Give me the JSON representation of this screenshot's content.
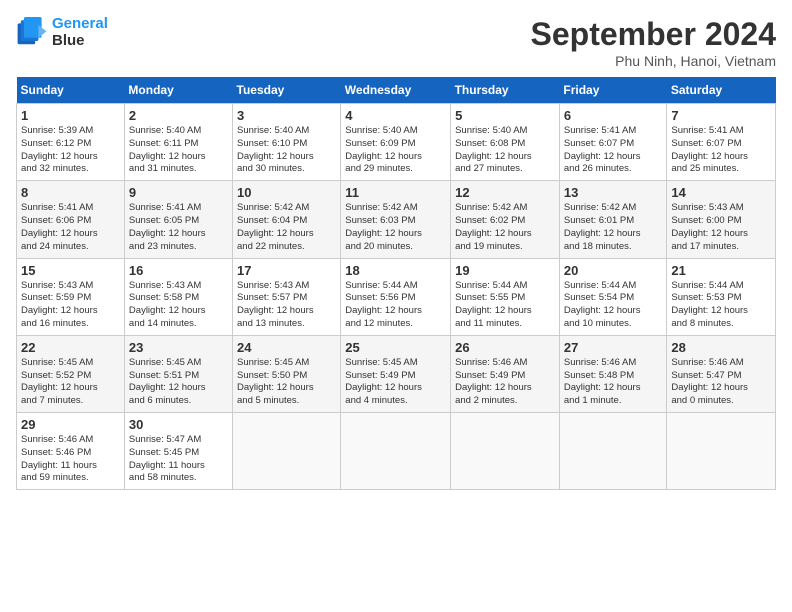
{
  "header": {
    "logo_line1": "General",
    "logo_line2": "Blue",
    "month_title": "September 2024",
    "subtitle": "Phu Ninh, Hanoi, Vietnam"
  },
  "days_of_week": [
    "Sunday",
    "Monday",
    "Tuesday",
    "Wednesday",
    "Thursday",
    "Friday",
    "Saturday"
  ],
  "weeks": [
    [
      {
        "day": "1",
        "info": "Sunrise: 5:39 AM\nSunset: 6:12 PM\nDaylight: 12 hours\nand 32 minutes."
      },
      {
        "day": "2",
        "info": "Sunrise: 5:40 AM\nSunset: 6:11 PM\nDaylight: 12 hours\nand 31 minutes."
      },
      {
        "day": "3",
        "info": "Sunrise: 5:40 AM\nSunset: 6:10 PM\nDaylight: 12 hours\nand 30 minutes."
      },
      {
        "day": "4",
        "info": "Sunrise: 5:40 AM\nSunset: 6:09 PM\nDaylight: 12 hours\nand 29 minutes."
      },
      {
        "day": "5",
        "info": "Sunrise: 5:40 AM\nSunset: 6:08 PM\nDaylight: 12 hours\nand 27 minutes."
      },
      {
        "day": "6",
        "info": "Sunrise: 5:41 AM\nSunset: 6:07 PM\nDaylight: 12 hours\nand 26 minutes."
      },
      {
        "day": "7",
        "info": "Sunrise: 5:41 AM\nSunset: 6:07 PM\nDaylight: 12 hours\nand 25 minutes."
      }
    ],
    [
      {
        "day": "8",
        "info": "Sunrise: 5:41 AM\nSunset: 6:06 PM\nDaylight: 12 hours\nand 24 minutes."
      },
      {
        "day": "9",
        "info": "Sunrise: 5:41 AM\nSunset: 6:05 PM\nDaylight: 12 hours\nand 23 minutes."
      },
      {
        "day": "10",
        "info": "Sunrise: 5:42 AM\nSunset: 6:04 PM\nDaylight: 12 hours\nand 22 minutes."
      },
      {
        "day": "11",
        "info": "Sunrise: 5:42 AM\nSunset: 6:03 PM\nDaylight: 12 hours\nand 20 minutes."
      },
      {
        "day": "12",
        "info": "Sunrise: 5:42 AM\nSunset: 6:02 PM\nDaylight: 12 hours\nand 19 minutes."
      },
      {
        "day": "13",
        "info": "Sunrise: 5:42 AM\nSunset: 6:01 PM\nDaylight: 12 hours\nand 18 minutes."
      },
      {
        "day": "14",
        "info": "Sunrise: 5:43 AM\nSunset: 6:00 PM\nDaylight: 12 hours\nand 17 minutes."
      }
    ],
    [
      {
        "day": "15",
        "info": "Sunrise: 5:43 AM\nSunset: 5:59 PM\nDaylight: 12 hours\nand 16 minutes."
      },
      {
        "day": "16",
        "info": "Sunrise: 5:43 AM\nSunset: 5:58 PM\nDaylight: 12 hours\nand 14 minutes."
      },
      {
        "day": "17",
        "info": "Sunrise: 5:43 AM\nSunset: 5:57 PM\nDaylight: 12 hours\nand 13 minutes."
      },
      {
        "day": "18",
        "info": "Sunrise: 5:44 AM\nSunset: 5:56 PM\nDaylight: 12 hours\nand 12 minutes."
      },
      {
        "day": "19",
        "info": "Sunrise: 5:44 AM\nSunset: 5:55 PM\nDaylight: 12 hours\nand 11 minutes."
      },
      {
        "day": "20",
        "info": "Sunrise: 5:44 AM\nSunset: 5:54 PM\nDaylight: 12 hours\nand 10 minutes."
      },
      {
        "day": "21",
        "info": "Sunrise: 5:44 AM\nSunset: 5:53 PM\nDaylight: 12 hours\nand 8 minutes."
      }
    ],
    [
      {
        "day": "22",
        "info": "Sunrise: 5:45 AM\nSunset: 5:52 PM\nDaylight: 12 hours\nand 7 minutes."
      },
      {
        "day": "23",
        "info": "Sunrise: 5:45 AM\nSunset: 5:51 PM\nDaylight: 12 hours\nand 6 minutes."
      },
      {
        "day": "24",
        "info": "Sunrise: 5:45 AM\nSunset: 5:50 PM\nDaylight: 12 hours\nand 5 minutes."
      },
      {
        "day": "25",
        "info": "Sunrise: 5:45 AM\nSunset: 5:49 PM\nDaylight: 12 hours\nand 4 minutes."
      },
      {
        "day": "26",
        "info": "Sunrise: 5:46 AM\nSunset: 5:49 PM\nDaylight: 12 hours\nand 2 minutes."
      },
      {
        "day": "27",
        "info": "Sunrise: 5:46 AM\nSunset: 5:48 PM\nDaylight: 12 hours\nand 1 minute."
      },
      {
        "day": "28",
        "info": "Sunrise: 5:46 AM\nSunset: 5:47 PM\nDaylight: 12 hours\nand 0 minutes."
      }
    ],
    [
      {
        "day": "29",
        "info": "Sunrise: 5:46 AM\nSunset: 5:46 PM\nDaylight: 11 hours\nand 59 minutes."
      },
      {
        "day": "30",
        "info": "Sunrise: 5:47 AM\nSunset: 5:45 PM\nDaylight: 11 hours\nand 58 minutes."
      },
      {
        "day": "",
        "info": ""
      },
      {
        "day": "",
        "info": ""
      },
      {
        "day": "",
        "info": ""
      },
      {
        "day": "",
        "info": ""
      },
      {
        "day": "",
        "info": ""
      }
    ]
  ]
}
